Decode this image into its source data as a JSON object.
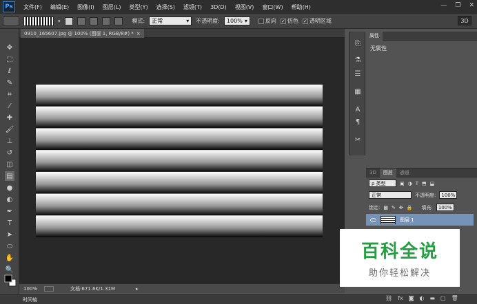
{
  "app": {
    "logo_text": "Ps",
    "accent": "#46a0f0"
  },
  "menu": [
    "文件(F)",
    "编辑(E)",
    "图像(I)",
    "图层(L)",
    "类型(Y)",
    "选择(S)",
    "滤镜(T)",
    "3D(D)",
    "视图(V)",
    "窗口(W)",
    "帮助(H)"
  ],
  "options": {
    "mode_label": "模式:",
    "mode_value": "正常",
    "opacity_label": "不透明度:",
    "opacity_value": "100%",
    "reverse_label": "反向",
    "dither_label": "仿色",
    "transparency_label": "透明区域",
    "three_d_label": "3D",
    "reverse_checked": false,
    "dither_checked": true,
    "transparency_checked": true
  },
  "document": {
    "tab_title": "0910_165607.jpg @ 100% (图层 1, RGB/8#) *",
    "close": "×",
    "stripes": 7
  },
  "status": {
    "zoom": "100%",
    "doc_info": "文档:671.6K/1.31M"
  },
  "timeline": {
    "label": "时间轴"
  },
  "properties": {
    "tab": "属性",
    "body": "无属性"
  },
  "layers_panel": {
    "tabs": [
      "3D",
      "图层",
      "通道"
    ],
    "filter_label": "ρ 类型",
    "blend_mode": "正常",
    "opacity_label": "不透明度:",
    "opacity_value": "100%",
    "lock_label": "锁定:",
    "fill_label": "填充:",
    "fill_value": "100%",
    "layer_name": "图层 1"
  },
  "watermark": {
    "title": "百科全说",
    "subtitle": "助你轻松解决",
    "color": "#22a040"
  }
}
